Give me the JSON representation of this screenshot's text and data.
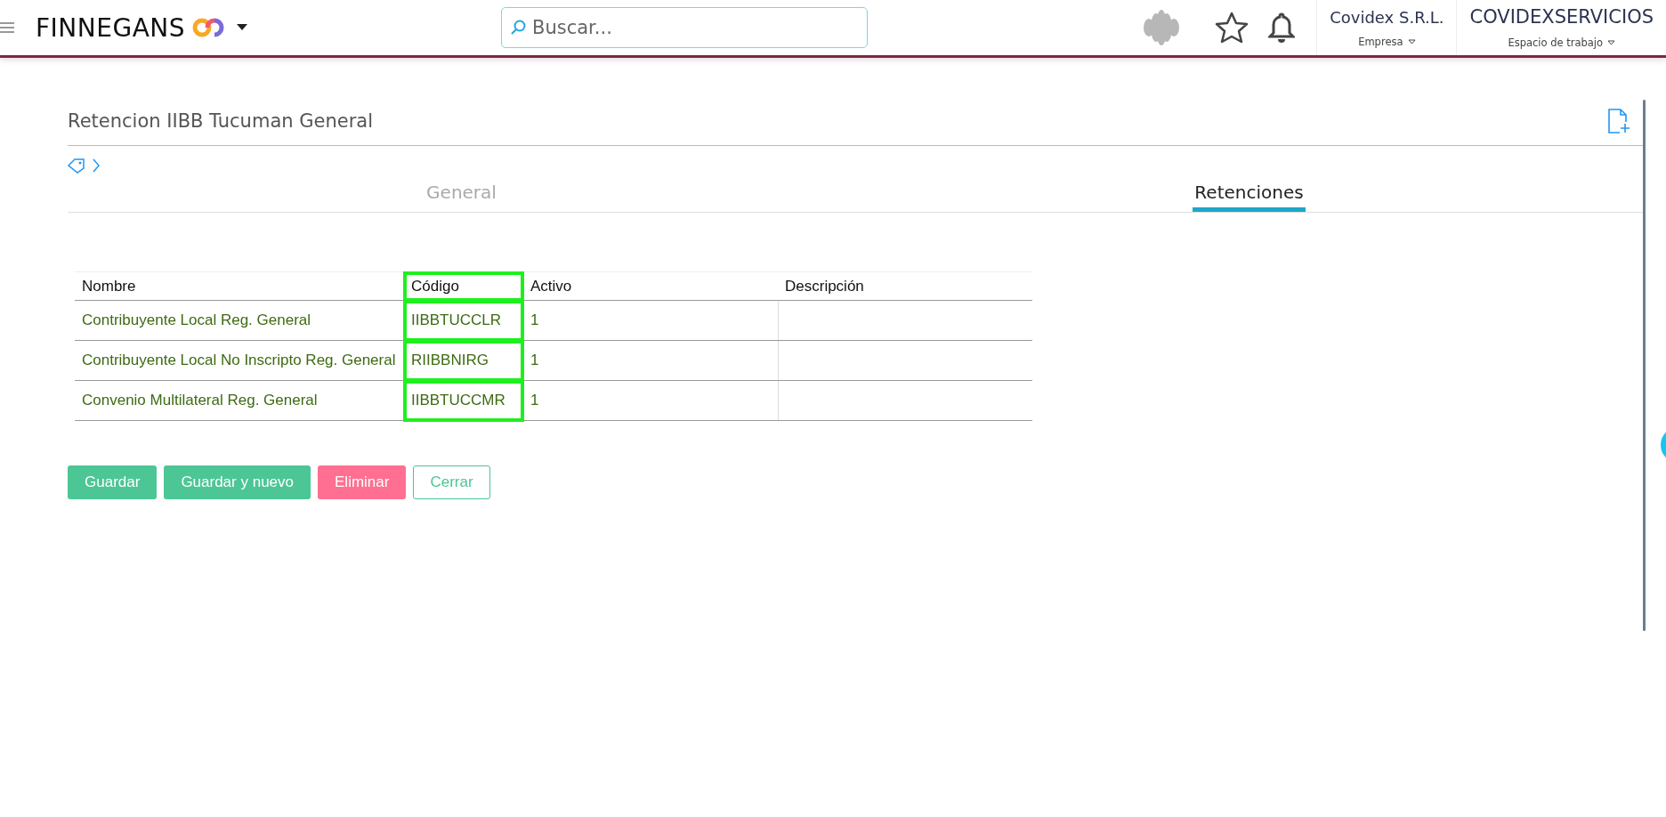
{
  "header": {
    "logo": "FINNEGANS",
    "search": {
      "placeholder": "Buscar..."
    },
    "company": {
      "name": "Covidex S.R.L.",
      "label": "Empresa"
    },
    "workspace": {
      "name": "COVIDEXSERVICIOS",
      "label": "Espacio de trabajo"
    }
  },
  "page": {
    "title": "Retencion IIBB Tucuman General"
  },
  "tabs": [
    {
      "label": "General",
      "selected": false
    },
    {
      "label": "Retenciones",
      "selected": true
    }
  ],
  "table": {
    "columns": [
      {
        "label": "Nombre",
        "highlighted": false
      },
      {
        "label": "Código",
        "highlighted": true
      },
      {
        "label": "Activo",
        "highlighted": false
      },
      {
        "label": "Descripción",
        "highlighted": false
      }
    ],
    "rows": [
      [
        "Contribuyente Local Reg. General",
        "IIBBTUCCLR",
        "1",
        ""
      ],
      [
        "Contribuyente Local No Inscripto Reg. General",
        "RIIBBNIRG",
        "1",
        ""
      ],
      [
        "Convenio Multilateral Reg. General",
        "IIBBTUCCMR",
        "1",
        ""
      ]
    ]
  },
  "buttons": [
    {
      "label": "Guardar",
      "kind": "primary"
    },
    {
      "label": "Guardar y nuevo",
      "kind": "primary"
    },
    {
      "label": "Eliminar",
      "kind": "danger"
    },
    {
      "label": "Cerrar",
      "kind": "outline"
    }
  ]
}
